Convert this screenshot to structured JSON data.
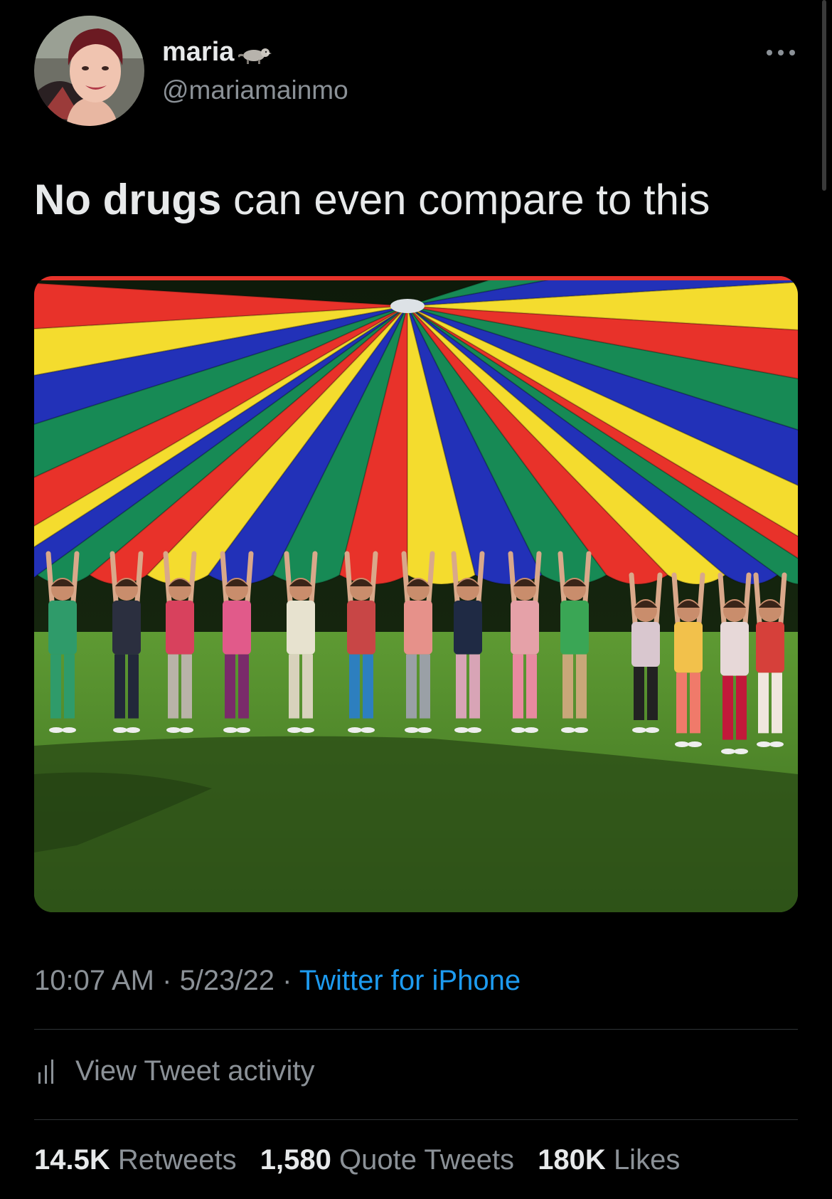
{
  "user": {
    "display_name": "maria",
    "name_emoji": "raccoon-icon",
    "handle": "@mariamainmo"
  },
  "tweet": {
    "text_bold": "No drugs",
    "text_rest": " can even compare to this"
  },
  "meta": {
    "time": "10:07 AM",
    "sep1": " · ",
    "date": "5/23/22",
    "sep2": " · ",
    "source": "Twitter for iPhone"
  },
  "activity": {
    "label": "View Tweet activity",
    "icon": "bar-chart-icon"
  },
  "stats": {
    "retweets_value": "14.5K",
    "retweets_label": "Retweets",
    "quotes_value": "1,580",
    "quotes_label": "Quote Tweets",
    "likes_value": "180K",
    "likes_label": "Likes"
  },
  "colors": {
    "background": "#000000",
    "text_primary": "#e7e9ea",
    "text_secondary": "#8b9197",
    "link": "#1d9bf0",
    "parachute_red": "#e8322a",
    "parachute_yellow": "#f4dc2e",
    "parachute_blue": "#2231b8",
    "parachute_green": "#178a55",
    "grass": "#4f8c2a"
  }
}
